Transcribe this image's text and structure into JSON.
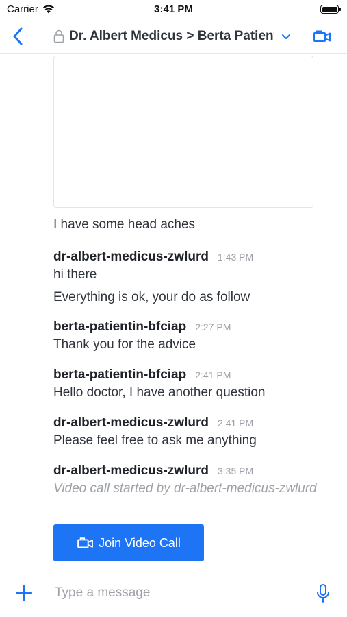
{
  "status_bar": {
    "carrier": "Carrier",
    "time": "3:41 PM"
  },
  "header": {
    "title": "Dr. Albert Medicus > Berta Patientin",
    "icons": [
      "back-chevron-icon",
      "lock-icon",
      "chevron-down-icon",
      "video-camera-icon"
    ]
  },
  "messages": {
    "image_caption": "I have some head aches",
    "items": [
      {
        "username": "dr-albert-medicus-zwlurd",
        "time": "1:43 PM",
        "texts": [
          "hi there",
          "Everything is ok, your do as follow"
        ]
      },
      {
        "username": "berta-patientin-bfciap",
        "time": "2:27 PM",
        "texts": [
          "Thank you for the advice"
        ]
      },
      {
        "username": "berta-patientin-bfciap",
        "time": "2:41 PM",
        "texts": [
          "Hello doctor, I have another question"
        ]
      },
      {
        "username": "dr-albert-medicus-zwlurd",
        "time": "2:41 PM",
        "texts": [
          "Please feel free to ask me anything"
        ]
      },
      {
        "username": "dr-albert-medicus-zwlurd",
        "time": "3:35 PM",
        "system_text": "Video call started by dr-albert-medicus-zwlurd"
      }
    ],
    "join_button_label": "Join Video Call"
  },
  "composer": {
    "placeholder": "Type a message"
  },
  "colors": {
    "accent": "#1d74f5",
    "text": "#2f343d",
    "muted": "#9ea2a8"
  }
}
